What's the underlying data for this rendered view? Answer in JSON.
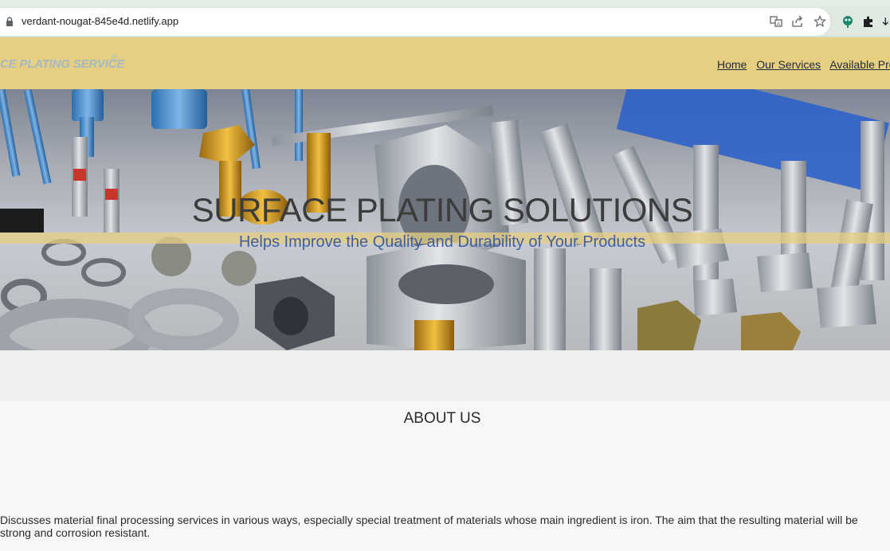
{
  "browser": {
    "url": "verdant-nougat-845e4d.netlify.app"
  },
  "header": {
    "brand": "CE PLATING SERVICE",
    "brand_mark": "©",
    "nav": [
      "Home",
      "Our Services",
      "Available Proje"
    ]
  },
  "hero": {
    "title": "SURFACE PLATING SOLUTIONS",
    "subtitle": "Helps Improve the Quality and Durability of Your Products"
  },
  "about": {
    "title": "ABOUT US",
    "text": "Discusses material final processing services in various ways, especially special treatment of materials whose main ingredient is iron. The aim that the resulting material will be strong and corrosion resistant."
  },
  "colors": {
    "header_bg": "#e6cf81",
    "hero_subtitle": "#3f5fa1",
    "page_bg": "#f6f7f9"
  }
}
